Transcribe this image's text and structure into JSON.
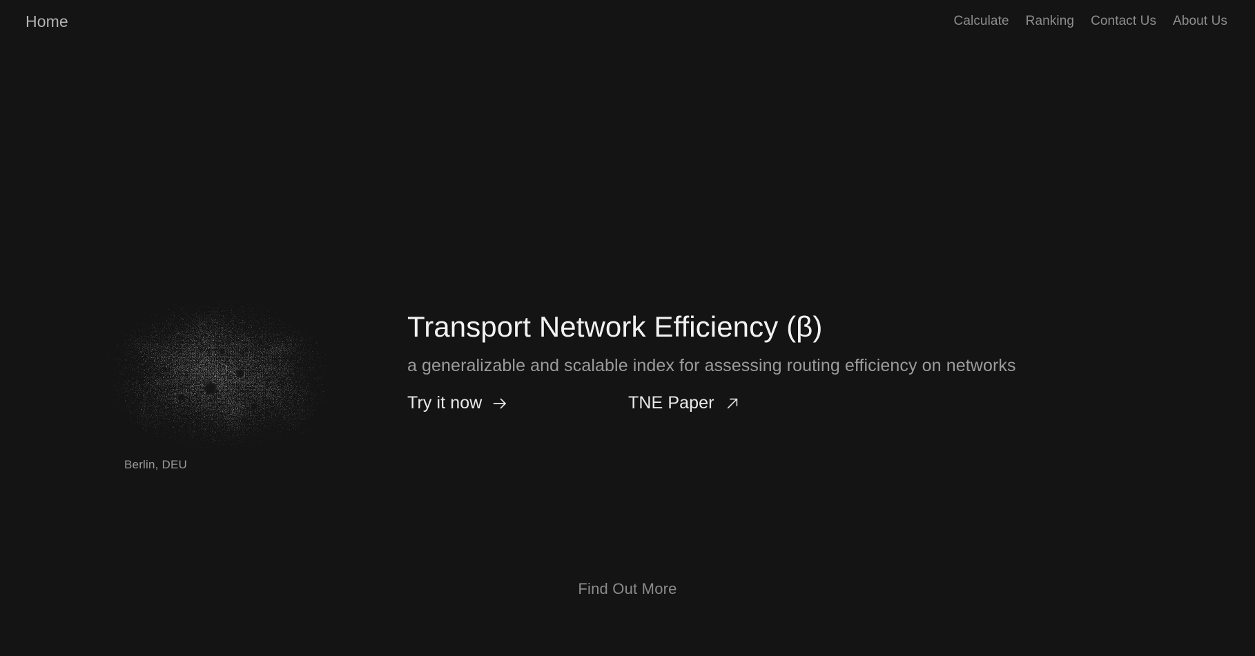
{
  "theme": {
    "background": "#141414",
    "text_primary": "#f2f2f2",
    "text_secondary": "#9b9b9b",
    "text_muted": "#8d8d8d",
    "node_color": "#ffffff"
  },
  "navbar": {
    "brand": "Home",
    "links": [
      {
        "label": "Calculate"
      },
      {
        "label": "Ranking"
      },
      {
        "label": "Contact Us"
      },
      {
        "label": "About Us"
      }
    ]
  },
  "hero": {
    "title": "Transport Network Efficiency (β)",
    "subtitle": "a generalizable and scalable index for assessing routing efficiency on networks",
    "cta_primary": {
      "label": "Try it now",
      "icon": "arrow-right-icon"
    },
    "cta_secondary": {
      "label": "TNE Paper",
      "icon": "arrow-up-right-icon"
    }
  },
  "figure": {
    "caption": "Berlin, DEU",
    "type": "street-network-point-cloud"
  },
  "footer": {
    "scroll_hint": "Find Out More"
  }
}
